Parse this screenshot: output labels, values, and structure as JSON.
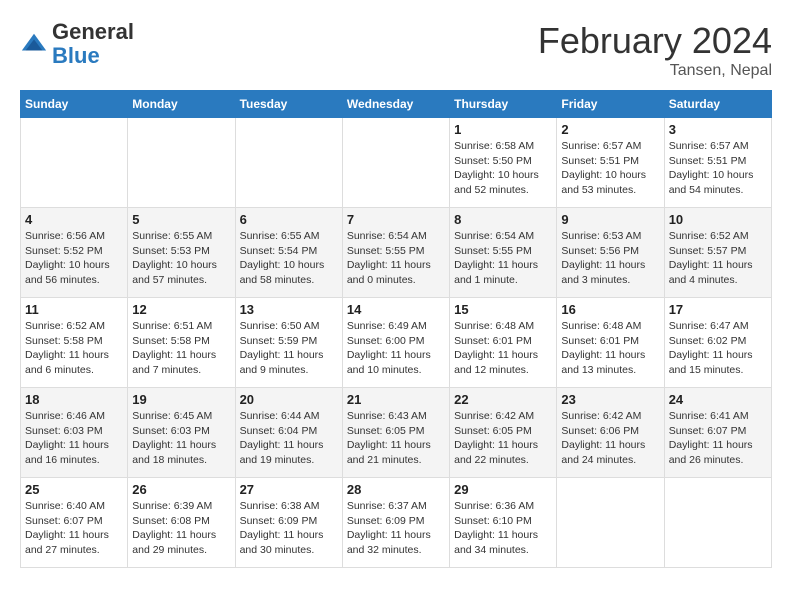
{
  "app": {
    "logo_general": "General",
    "logo_blue": "Blue"
  },
  "header": {
    "month": "February 2024",
    "location": "Tansen, Nepal"
  },
  "weekdays": [
    "Sunday",
    "Monday",
    "Tuesday",
    "Wednesday",
    "Thursday",
    "Friday",
    "Saturday"
  ],
  "weeks": [
    [
      {
        "day": "",
        "info": ""
      },
      {
        "day": "",
        "info": ""
      },
      {
        "day": "",
        "info": ""
      },
      {
        "day": "",
        "info": ""
      },
      {
        "day": "1",
        "info": "Sunrise: 6:58 AM\nSunset: 5:50 PM\nDaylight: 10 hours and 52 minutes."
      },
      {
        "day": "2",
        "info": "Sunrise: 6:57 AM\nSunset: 5:51 PM\nDaylight: 10 hours and 53 minutes."
      },
      {
        "day": "3",
        "info": "Sunrise: 6:57 AM\nSunset: 5:51 PM\nDaylight: 10 hours and 54 minutes."
      }
    ],
    [
      {
        "day": "4",
        "info": "Sunrise: 6:56 AM\nSunset: 5:52 PM\nDaylight: 10 hours and 56 minutes."
      },
      {
        "day": "5",
        "info": "Sunrise: 6:55 AM\nSunset: 5:53 PM\nDaylight: 10 hours and 57 minutes."
      },
      {
        "day": "6",
        "info": "Sunrise: 6:55 AM\nSunset: 5:54 PM\nDaylight: 10 hours and 58 minutes."
      },
      {
        "day": "7",
        "info": "Sunrise: 6:54 AM\nSunset: 5:55 PM\nDaylight: 11 hours and 0 minutes."
      },
      {
        "day": "8",
        "info": "Sunrise: 6:54 AM\nSunset: 5:55 PM\nDaylight: 11 hours and 1 minute."
      },
      {
        "day": "9",
        "info": "Sunrise: 6:53 AM\nSunset: 5:56 PM\nDaylight: 11 hours and 3 minutes."
      },
      {
        "day": "10",
        "info": "Sunrise: 6:52 AM\nSunset: 5:57 PM\nDaylight: 11 hours and 4 minutes."
      }
    ],
    [
      {
        "day": "11",
        "info": "Sunrise: 6:52 AM\nSunset: 5:58 PM\nDaylight: 11 hours and 6 minutes."
      },
      {
        "day": "12",
        "info": "Sunrise: 6:51 AM\nSunset: 5:58 PM\nDaylight: 11 hours and 7 minutes."
      },
      {
        "day": "13",
        "info": "Sunrise: 6:50 AM\nSunset: 5:59 PM\nDaylight: 11 hours and 9 minutes."
      },
      {
        "day": "14",
        "info": "Sunrise: 6:49 AM\nSunset: 6:00 PM\nDaylight: 11 hours and 10 minutes."
      },
      {
        "day": "15",
        "info": "Sunrise: 6:48 AM\nSunset: 6:01 PM\nDaylight: 11 hours and 12 minutes."
      },
      {
        "day": "16",
        "info": "Sunrise: 6:48 AM\nSunset: 6:01 PM\nDaylight: 11 hours and 13 minutes."
      },
      {
        "day": "17",
        "info": "Sunrise: 6:47 AM\nSunset: 6:02 PM\nDaylight: 11 hours and 15 minutes."
      }
    ],
    [
      {
        "day": "18",
        "info": "Sunrise: 6:46 AM\nSunset: 6:03 PM\nDaylight: 11 hours and 16 minutes."
      },
      {
        "day": "19",
        "info": "Sunrise: 6:45 AM\nSunset: 6:03 PM\nDaylight: 11 hours and 18 minutes."
      },
      {
        "day": "20",
        "info": "Sunrise: 6:44 AM\nSunset: 6:04 PM\nDaylight: 11 hours and 19 minutes."
      },
      {
        "day": "21",
        "info": "Sunrise: 6:43 AM\nSunset: 6:05 PM\nDaylight: 11 hours and 21 minutes."
      },
      {
        "day": "22",
        "info": "Sunrise: 6:42 AM\nSunset: 6:05 PM\nDaylight: 11 hours and 22 minutes."
      },
      {
        "day": "23",
        "info": "Sunrise: 6:42 AM\nSunset: 6:06 PM\nDaylight: 11 hours and 24 minutes."
      },
      {
        "day": "24",
        "info": "Sunrise: 6:41 AM\nSunset: 6:07 PM\nDaylight: 11 hours and 26 minutes."
      }
    ],
    [
      {
        "day": "25",
        "info": "Sunrise: 6:40 AM\nSunset: 6:07 PM\nDaylight: 11 hours and 27 minutes."
      },
      {
        "day": "26",
        "info": "Sunrise: 6:39 AM\nSunset: 6:08 PM\nDaylight: 11 hours and 29 minutes."
      },
      {
        "day": "27",
        "info": "Sunrise: 6:38 AM\nSunset: 6:09 PM\nDaylight: 11 hours and 30 minutes."
      },
      {
        "day": "28",
        "info": "Sunrise: 6:37 AM\nSunset: 6:09 PM\nDaylight: 11 hours and 32 minutes."
      },
      {
        "day": "29",
        "info": "Sunrise: 6:36 AM\nSunset: 6:10 PM\nDaylight: 11 hours and 34 minutes."
      },
      {
        "day": "",
        "info": ""
      },
      {
        "day": "",
        "info": ""
      }
    ]
  ]
}
